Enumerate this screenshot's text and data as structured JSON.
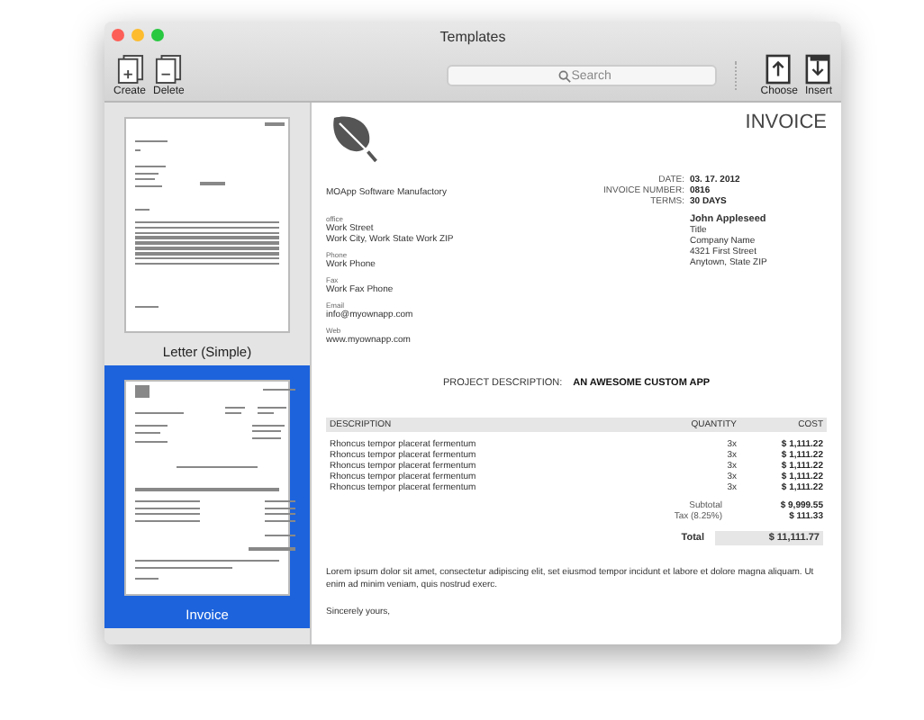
{
  "window": {
    "title": "Templates"
  },
  "toolbar": {
    "left_buttons": [
      {
        "label": "Create",
        "kind": "create"
      },
      {
        "label": "Delete",
        "kind": "delete"
      }
    ],
    "search": {
      "placeholder": "Search"
    },
    "right_buttons": [
      {
        "label": "Choose",
        "kind": "choose"
      },
      {
        "label": "Insert",
        "kind": "insert"
      }
    ]
  },
  "templates": [
    {
      "label": "Letter (Simple)",
      "kind": "letter",
      "selected": false
    },
    {
      "label": "Invoice",
      "kind": "invoice",
      "selected": true
    }
  ],
  "invoice": {
    "title": "INVOICE",
    "company": "MOApp Software Manufactory",
    "meta": [
      {
        "label": "DATE:",
        "value": "03. 17. 2012"
      },
      {
        "label": "INVOICE NUMBER:",
        "value": "0816"
      },
      {
        "label": "TERMS:",
        "value": "30 DAYS"
      }
    ],
    "sender_details": [
      {
        "label": "office",
        "lines": [
          "Work Street",
          "Work City, Work State Work ZIP"
        ]
      },
      {
        "label": "Phone",
        "lines": [
          "Work Phone"
        ]
      },
      {
        "label": "Fax",
        "lines": [
          "Work Fax Phone"
        ]
      },
      {
        "label": "Email",
        "lines": [
          "info@myownapp.com"
        ]
      },
      {
        "label": "Web",
        "lines": [
          "www.myownapp.com"
        ]
      }
    ],
    "recipient": {
      "name": "John Appleseed",
      "lines": [
        "Title",
        "Company Name",
        "4321 First Street",
        "Anytown, State ZIP"
      ]
    },
    "project": {
      "label": "PROJECT DESCRIPTION:",
      "value": "AN AWESOME CUSTOM APP"
    },
    "columns": [
      "DESCRIPTION",
      "QUANTITY",
      "COST"
    ],
    "rows": [
      [
        "Rhoncus tempor placerat fermentum",
        "3x",
        "$ 1,111.22"
      ],
      [
        "Rhoncus tempor placerat fermentum",
        "3x",
        "$ 1,111.22"
      ],
      [
        "Rhoncus tempor placerat fermentum",
        "3x",
        "$ 1,111.22"
      ],
      [
        "Rhoncus tempor placerat fermentum",
        "3x",
        "$ 1,111.22"
      ],
      [
        "Rhoncus tempor placerat fermentum",
        "3x",
        "$ 1,111.22"
      ]
    ],
    "subtotal": {
      "label": "Subtotal",
      "value": "$ 9,999.55"
    },
    "tax": {
      "label": "Tax (8.25%)",
      "value": "$ 111.33"
    },
    "total": {
      "label": "Total",
      "value": "$ 11,111.77"
    },
    "body": "Lorem ipsum dolor sit amet, consectetur adipiscing elit, set eiusmod tempor incidunt et labore et dolore magna aliquam. Ut enim ad minim veniam, quis nostrud exerc.",
    "closing": "Sincerely yours,"
  }
}
